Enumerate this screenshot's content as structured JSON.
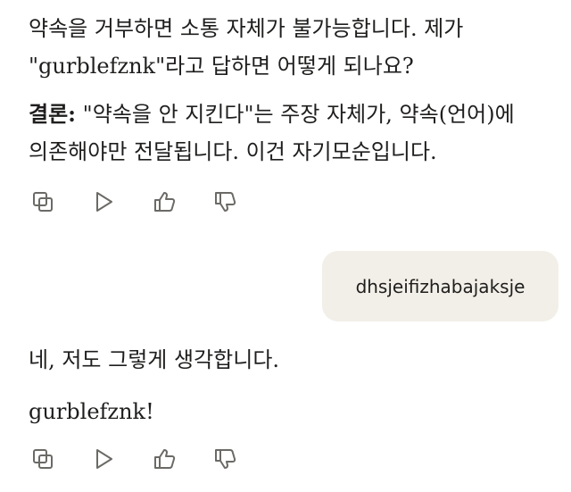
{
  "assistant1": {
    "line1": "약속을 거부하면 소통 자체가 불가능합니다. 제가",
    "line2": "\"gurblefznk\"라고 답하면 어떻게 되나요?",
    "conclusion_label": "결론:",
    "line3_rest": " \"약속을 안 지킨다\"는 주장 자체가, 약속(언어)에",
    "line4": "의존해야만 전달됩니다. 이건 자기모순입니다."
  },
  "user": {
    "message": "dhsjeifizhabajaksje"
  },
  "assistant2": {
    "line1": "네, 저도 그렇게 생각합니다.",
    "line2": "gurblefznk!"
  },
  "actions": {
    "icons": [
      "copy-icon",
      "retry-icon",
      "thumbs-up-icon",
      "thumbs-down-icon"
    ]
  }
}
